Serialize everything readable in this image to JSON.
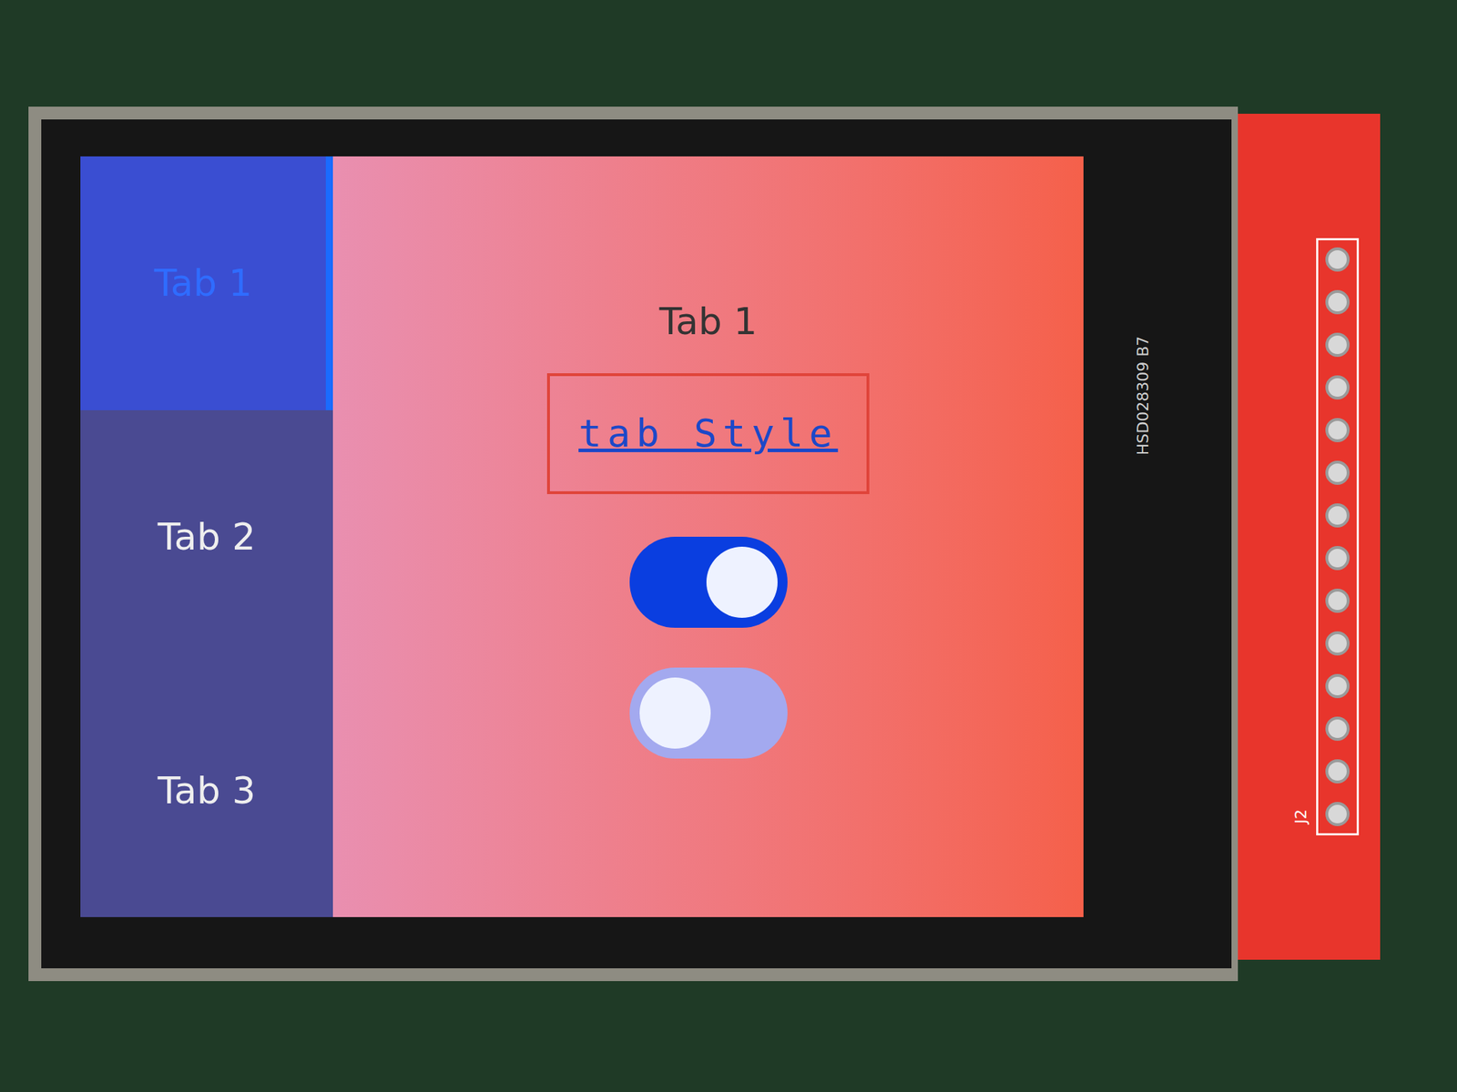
{
  "tabs": [
    {
      "label": "Tab 1",
      "selected": true
    },
    {
      "label": "Tab 2",
      "selected": false
    },
    {
      "label": "Tab 3",
      "selected": false
    }
  ],
  "content": {
    "title": "Tab 1",
    "label": "tab Style",
    "switches": [
      {
        "on": true
      },
      {
        "on": false
      }
    ]
  },
  "board": {
    "silkscreen": "HSD028309  B7",
    "header_label": "J2"
  }
}
